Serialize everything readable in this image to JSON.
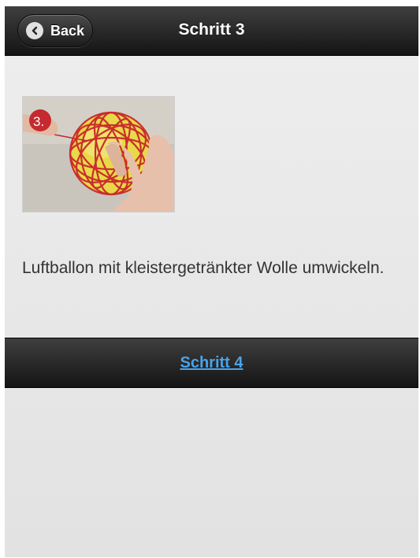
{
  "header": {
    "back_label": "Back",
    "title": "Schritt 3"
  },
  "step_image": {
    "step_badge": "3."
  },
  "content": {
    "description": "Luftballon mit kleistergetränkter Wolle umwickeln."
  },
  "footer": {
    "next_link": "Schritt 4"
  },
  "colors": {
    "bar_dark": "#141414",
    "link_blue": "#4aa3e8",
    "page_bg": "#e8e8e8"
  }
}
